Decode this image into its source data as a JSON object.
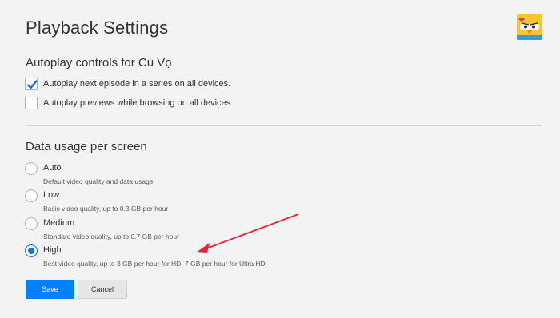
{
  "page": {
    "title": "Playback Settings"
  },
  "autoplay": {
    "heading": "Autoplay controls for Cú Vọ",
    "options": [
      {
        "label": "Autoplay next episode in a series on all devices.",
        "checked": true
      },
      {
        "label": "Autoplay previews while browsing on all devices.",
        "checked": false
      }
    ]
  },
  "data_usage": {
    "heading": "Data usage per screen",
    "selected": "High",
    "options": [
      {
        "title": "Auto",
        "desc": "Default video quality and data usage"
      },
      {
        "title": "Low",
        "desc": "Basic video quality, up to 0.3 GB per hour"
      },
      {
        "title": "Medium",
        "desc": "Standard video quality, up to 0.7 GB per hour"
      },
      {
        "title": "High",
        "desc": "Best video quality, up to 3 GB per hour for HD, 7 GB per hour for Ultra HD"
      }
    ]
  },
  "buttons": {
    "save_label": "Save",
    "cancel_label": "Cancel"
  },
  "icons": {
    "avatar": "cartoon-chick-avatar-icon",
    "checkmark": "checkmark-icon",
    "annotation": "red-arrow-annotation"
  },
  "colors": {
    "accent": "#0080ff",
    "radio_selected": "#0071eb",
    "checkmark": "#0071eb",
    "annotation_arrow": "#e8253c",
    "background": "#f3f3f3"
  }
}
